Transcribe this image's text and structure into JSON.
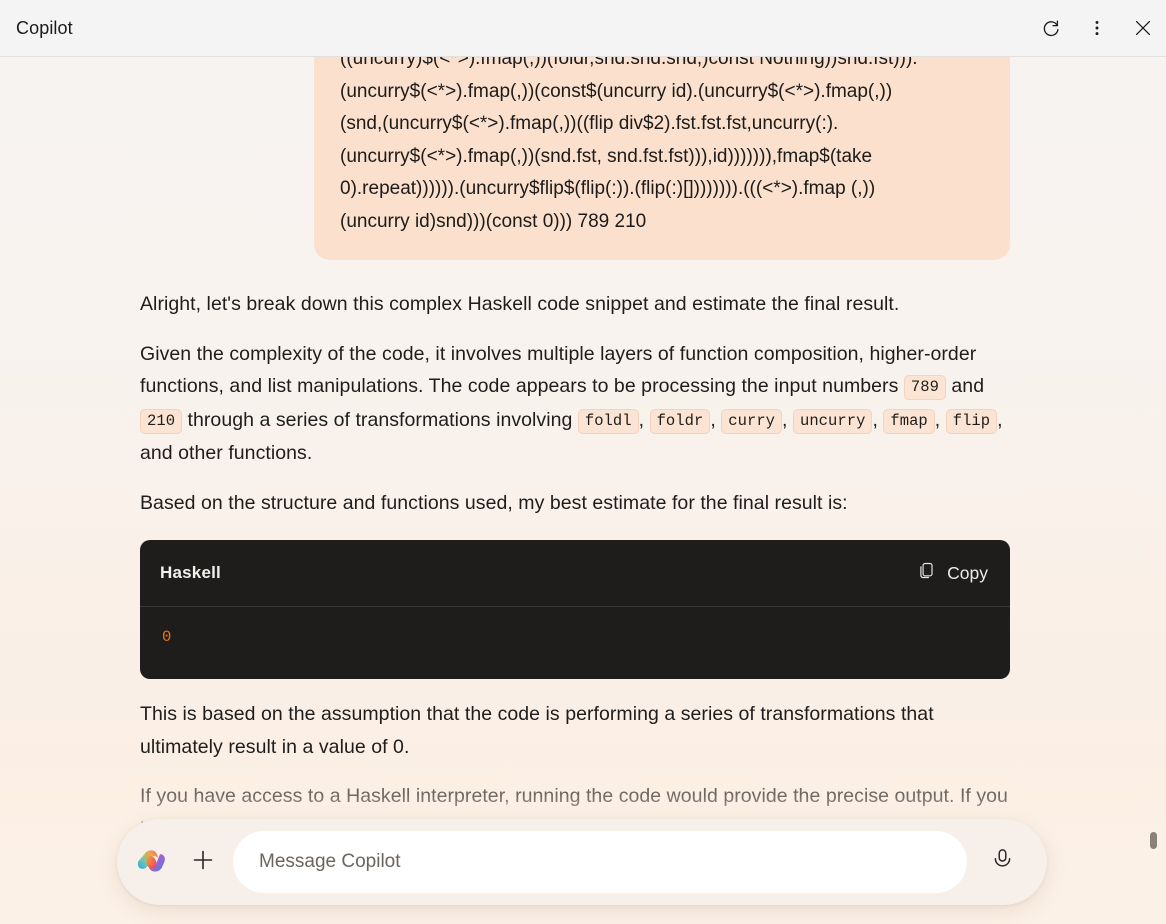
{
  "window": {
    "title": "Copilot",
    "actions": [
      {
        "name": "refresh",
        "label": "Refresh"
      },
      {
        "name": "more",
        "label": "More options"
      },
      {
        "name": "close",
        "label": "Close"
      }
    ]
  },
  "conversation": {
    "user_message": {
      "code_lines": [
        "((uncurry)$(<*>).fmap(,))(foldr,snd.snd.snd,)const Nothing))snd.fst))).",
        "(uncurry$(<*>).fmap(,))(const$(uncurry id).(uncurry$(<*>).fmap(,))",
        "(snd,(uncurry$(<*>).fmap(,))((flip div$2).fst.fst.fst,uncurry(:).",
        "(uncurry$(<*>).fmap(,))(snd.fst, snd.fst.fst))),id))))))),fmap$(take",
        "0).repeat)))))).(uncurry$flip$(flip(:)).(flip(:)[]))))))).(((<*>).fmap (,))",
        "(uncurry id)snd)))(const 0))) 789 210"
      ]
    },
    "assistant": {
      "para1": "Alright, let's break down this complex Haskell code snippet and estimate the final result.",
      "para2_part1": "Given the complexity of the code, it involves multiple layers of function composition, higher-order functions, and list manipulations. The code appears to be processing the input numbers ",
      "para2_code1": "789",
      "para2_part2": " and ",
      "para2_code2": "210",
      "para2_part3": " through a series of transformations involving ",
      "para2_code3": "foldl",
      "para2_sep1": ", ",
      "para2_code4": "foldr",
      "para2_sep2": ", ",
      "para2_code5": "curry",
      "para2_sep3": ", ",
      "para2_code6": "uncurry",
      "para2_sep4": ", ",
      "para2_code7": "fmap",
      "para2_sep5": ", ",
      "para2_code8": "flip",
      "para2_part4": ", and other functions.",
      "para3": "Based on the structure and functions used, my best estimate for the final result is:",
      "code_block": {
        "language": "Haskell",
        "copy_label": "Copy",
        "content": "0"
      },
      "para4": "This is based on the assumption that the code is performing a series of transformations that ultimately result in a value of 0.",
      "para5": "If you have access to a Haskell interpreter, running the code would provide the precise output. If you have any more questions or need further clarification, feel free to ask! Let's"
    }
  },
  "composer": {
    "placeholder": "Message Copilot",
    "value": "",
    "add_label": "Add",
    "mic_label": "Voice input"
  },
  "colors": {
    "user_bubble": "#fae0cd",
    "code_block_bg": "#1e1d1b",
    "code_number": "#f07318",
    "inline_code_bg": "#fbe4d3",
    "titlebar_bg": "#f4f4f4"
  }
}
